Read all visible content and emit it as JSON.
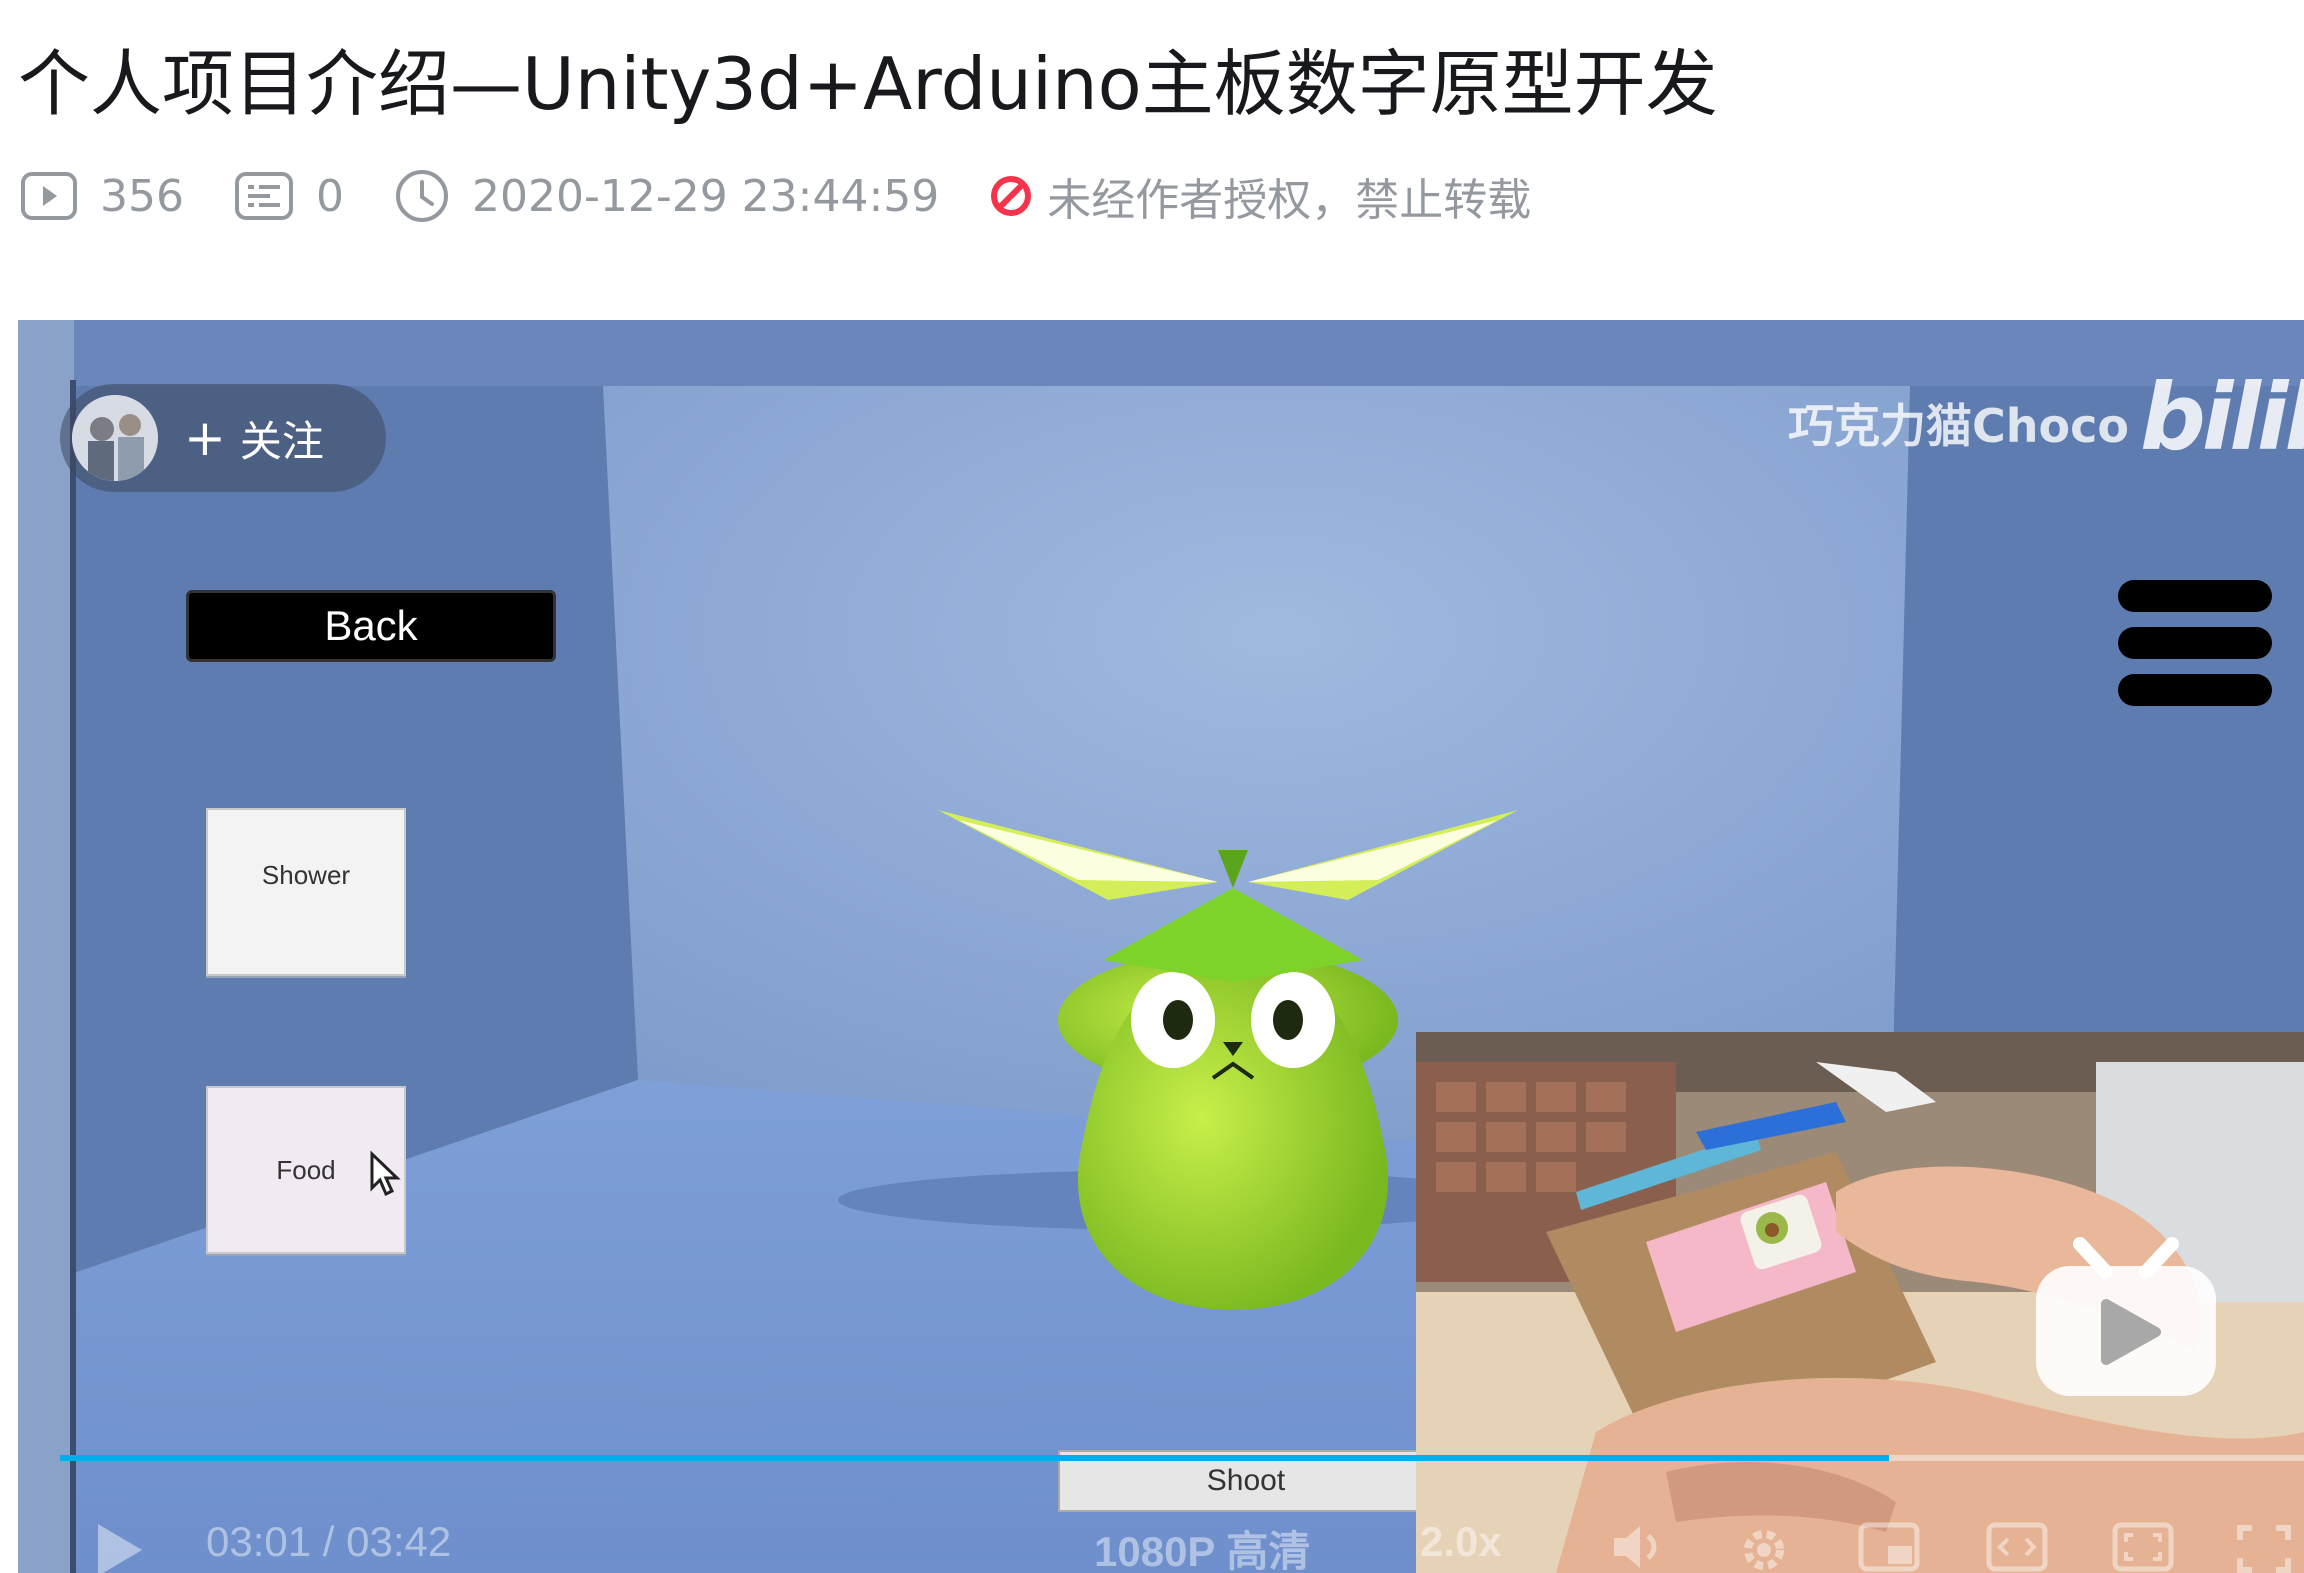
{
  "page_title": "个人项目介绍—Unity3d+Arduino主板数字原型开发",
  "stats": {
    "views": "356",
    "comments": "0",
    "datetime": "2020-12-29 23:44:59",
    "copyright_notice": "未经作者授权，禁止转载"
  },
  "player": {
    "follow_plus": "+",
    "follow_label": "关注",
    "uploader": "巧克力猫Choco",
    "logo_text": "bilibili",
    "game_ui": {
      "back_label": "Back",
      "shower_label": "Shower",
      "food_label": "Food",
      "shoot_label": "Shoot"
    },
    "current_time": "03:01",
    "time_separator": "/",
    "duration": "03:42",
    "quality": "1080P 高清",
    "speed": "2.0x",
    "progress_fraction": 0.815
  },
  "colors": {
    "accent_progress": "#00aeec",
    "forbidden_red": "#f5334b",
    "meta_gray": "#9499a0"
  }
}
